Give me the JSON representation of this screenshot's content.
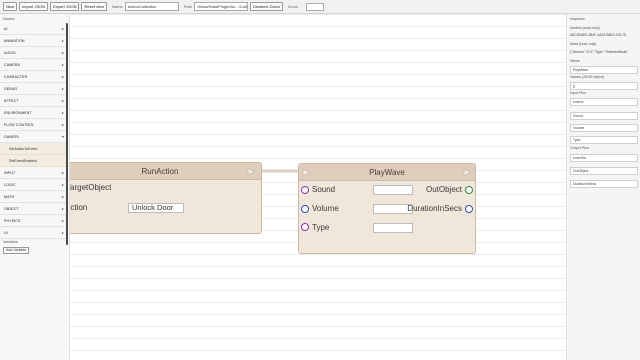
{
  "toolbar": {
    "new_label": "New",
    "import_label": "Import JSON",
    "export_label": "Export JSON",
    "reset_label": "Reset view",
    "name_field": "ActionCollection",
    "path_field": "Views/Data/Plugin/Ac.../Collecting",
    "deselect_label": "Deselect Zoom"
  },
  "sidebar": {
    "title": "Nodes",
    "categories": [
      "AI",
      "ANIMATION",
      "AUDIO",
      "CAMERA",
      "CHARACTER",
      "DEBUG",
      "EFFECT",
      "ENVIRONMENT",
      "FLOW CONTROL",
      "GAMEPL"
    ],
    "expanded_items": [
      "SetActionToEvent",
      "SetEventEnabled"
    ],
    "categories_after": [
      "INPUT",
      "LOGIC",
      "MATH",
      "OBJECT",
      "PHYSICS",
      "UI"
    ],
    "variables_label": "Variables",
    "add_variable_label": "Add Variable"
  },
  "nodes": {
    "run_action": {
      "title": "RunAction",
      "pin1_label": "TargetObject",
      "pin2_label": "Action",
      "action_value": "Unlock Door"
    },
    "play_wave": {
      "title": "PlayWave",
      "inputs": [
        "Sound",
        "Volume",
        "Type"
      ],
      "outputs": [
        "OutObject",
        "DurationInSecs"
      ]
    }
  },
  "inspector": {
    "title": "Inspector",
    "node_id_label": "NodeId (read-only)",
    "node_id_value": "A6C3D6E9-1B4F-4A32-B6E0-C0L7D",
    "meta_label": "Meta (read-only)",
    "meta_value": "{\"Version\":\"0.0\",\"Type\":\"SelectedNode\"",
    "name_label": "Name",
    "name_value": "PlayWave",
    "values_label": "Values (JSON object)",
    "values_value": "{}",
    "input_pins_label": "Input Pins",
    "input_pins": [
      "InnerIn",
      "Sound",
      "Volume",
      "Type"
    ],
    "output_pins_label": "Output Pins",
    "output_pins": [
      "InnerOut",
      "OutObject",
      "DurationInSecs"
    ]
  },
  "colors": {
    "node_body": "#f1e6da",
    "node_header": "#e0cebd",
    "pin_object": "#8b2fb0",
    "pin_float": "#2e4fa5",
    "pin_output": "#2e8a3a"
  }
}
